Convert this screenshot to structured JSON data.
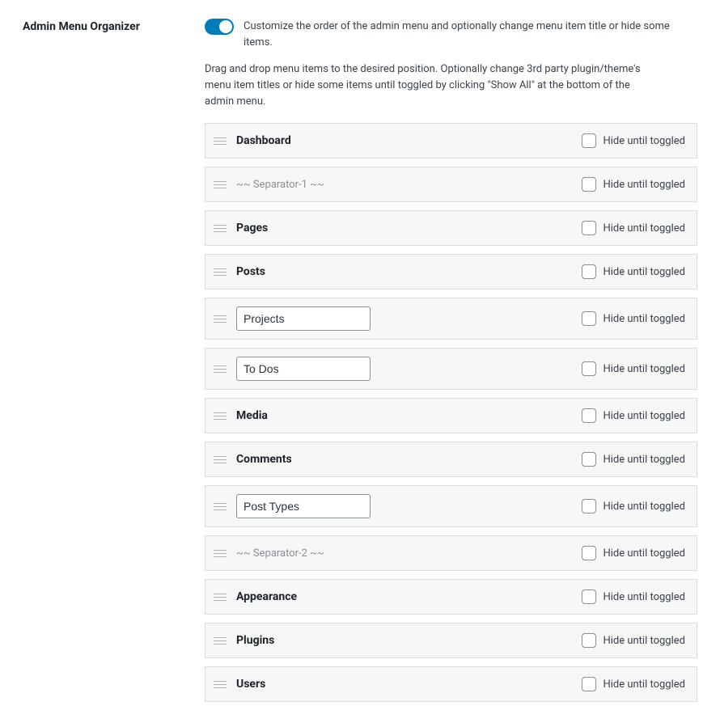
{
  "section_title": "Admin Menu Organizer",
  "toggle_on": true,
  "short_desc": "Customize the order of the admin menu and optionally change menu item title or hide some items.",
  "long_desc": "Drag and drop menu items to the desired position. Optionally change 3rd party plugin/theme's menu item titles or hide some items until toggled by clicking \"Show All\" at the bottom of the admin menu.",
  "hide_label": "Hide until toggled",
  "items": [
    {
      "label": "Dashboard",
      "editable": false,
      "separator": false
    },
    {
      "label": "~~ Separator-1 ~~",
      "editable": false,
      "separator": true
    },
    {
      "label": "Pages",
      "editable": false,
      "separator": false
    },
    {
      "label": "Posts",
      "editable": false,
      "separator": false
    },
    {
      "label": "Projects",
      "editable": true,
      "separator": false
    },
    {
      "label": "To Dos",
      "editable": true,
      "separator": false
    },
    {
      "label": "Media",
      "editable": false,
      "separator": false
    },
    {
      "label": "Comments",
      "editable": false,
      "separator": false
    },
    {
      "label": "Post Types",
      "editable": true,
      "separator": false
    },
    {
      "label": "~~ Separator-2 ~~",
      "editable": false,
      "separator": true
    },
    {
      "label": "Appearance",
      "editable": false,
      "separator": false
    },
    {
      "label": "Plugins",
      "editable": false,
      "separator": false
    },
    {
      "label": "Users",
      "editable": false,
      "separator": false
    }
  ]
}
